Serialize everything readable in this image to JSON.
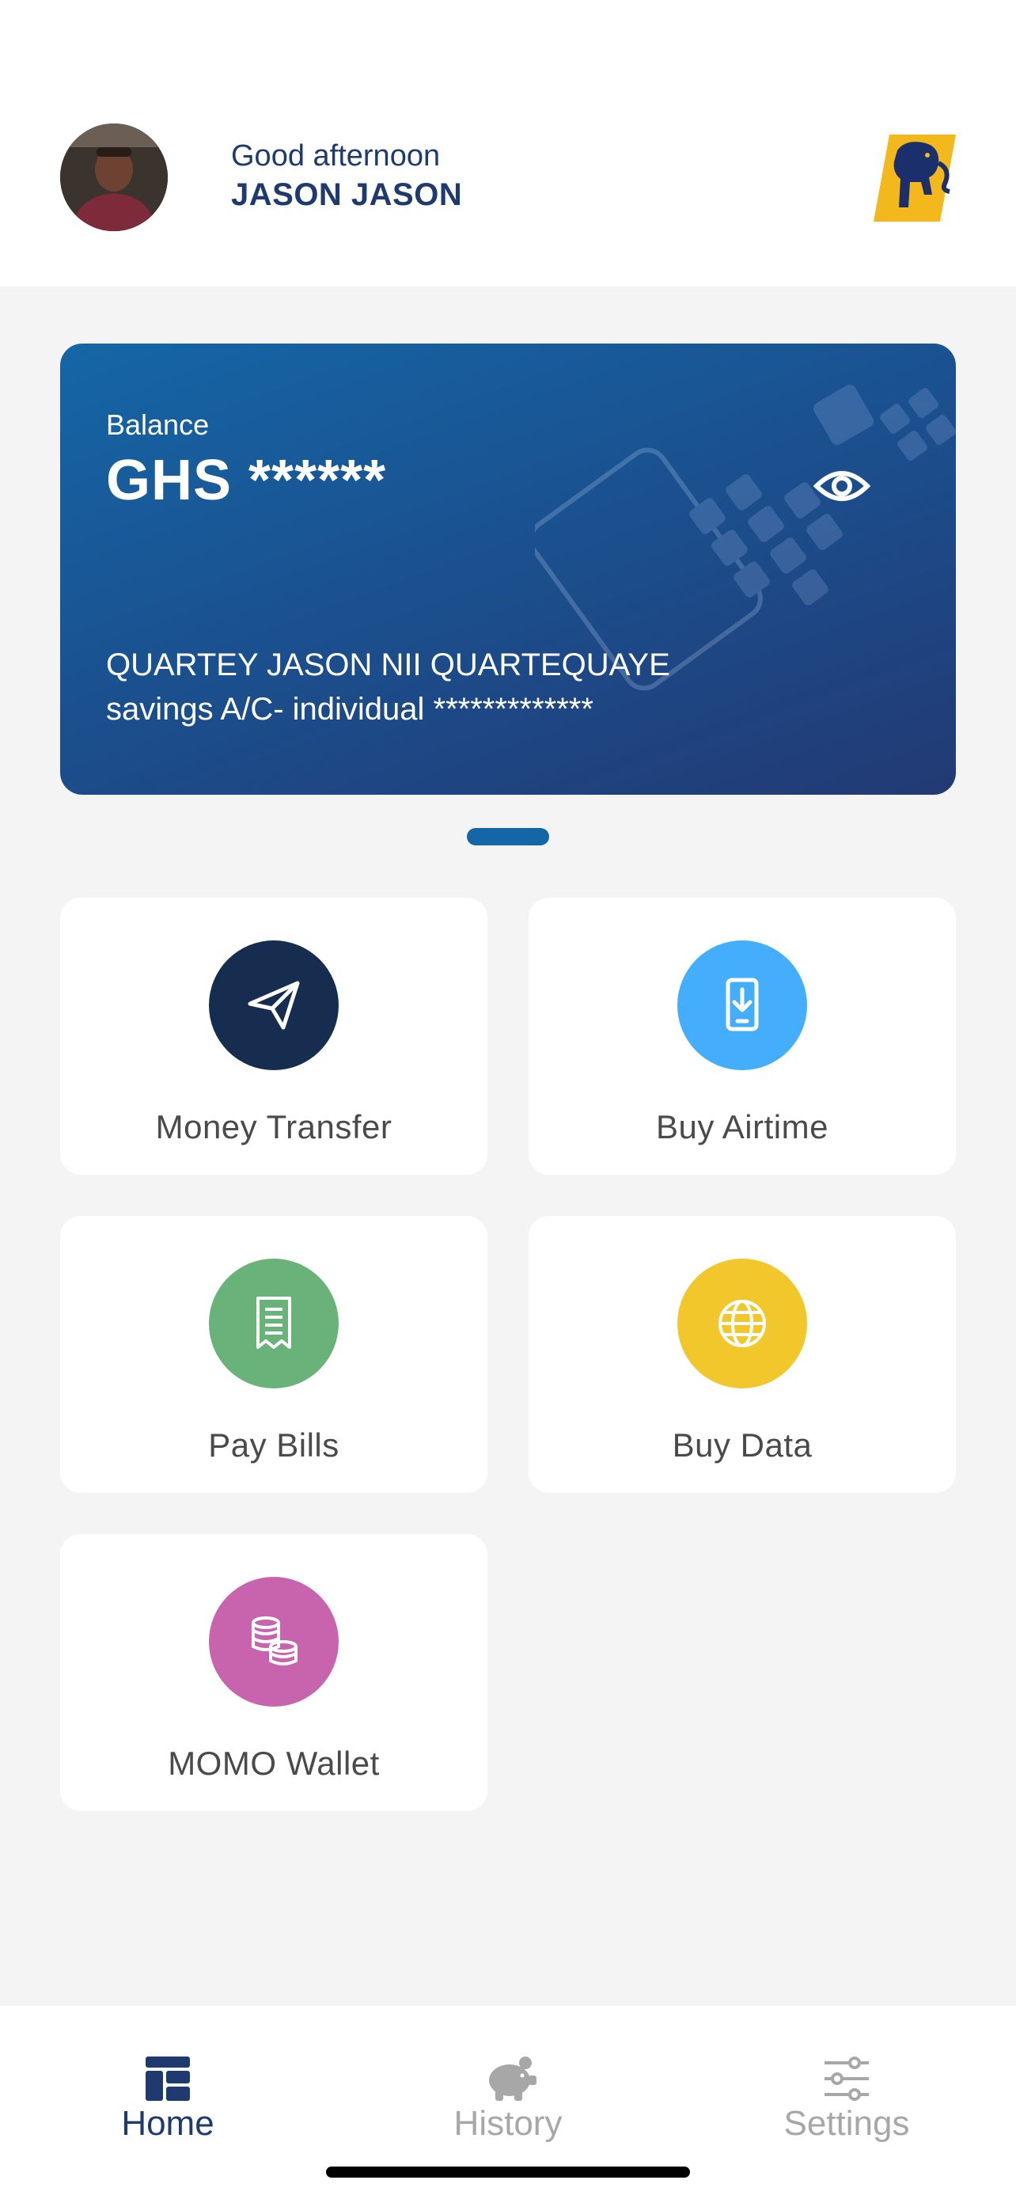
{
  "header": {
    "greeting": "Good afternoon",
    "user_name": "JASON JASON",
    "avatar_icon": "user-photo",
    "logo_icon": "elephant-logo"
  },
  "card": {
    "balance_label": "Balance",
    "balance_value": "GHS ******",
    "account_name": "QUARTEY JASON NII QUARTEQUAYE",
    "account_type": "savings A/C- individual *************",
    "visibility_icon": "eye-icon",
    "colors": {
      "start": "#1566a6",
      "end": "#223a74"
    }
  },
  "pager": {
    "active_index": 0,
    "count": 1
  },
  "tiles": [
    {
      "label": "Money Transfer",
      "icon": "paper-plane-icon",
      "color": "#162d50"
    },
    {
      "label": "Buy Airtime",
      "icon": "phone-download-icon",
      "color": "#45aefc"
    },
    {
      "label": "Pay Bills",
      "icon": "receipt-icon",
      "color": "#69b279"
    },
    {
      "label": "Buy Data",
      "icon": "globe-icon",
      "color": "#f1c72b"
    },
    {
      "label": "MOMO Wallet",
      "icon": "coins-icon",
      "color": "#c764ad"
    }
  ],
  "nav": {
    "items": [
      {
        "label": "Home",
        "icon": "dashboard-icon",
        "active": true
      },
      {
        "label": "History",
        "icon": "piggy-bank-icon",
        "active": false
      },
      {
        "label": "Settings",
        "icon": "sliders-icon",
        "active": false
      }
    ],
    "active_color": "#1e3a6e",
    "inactive_color": "#a7a7a7"
  }
}
